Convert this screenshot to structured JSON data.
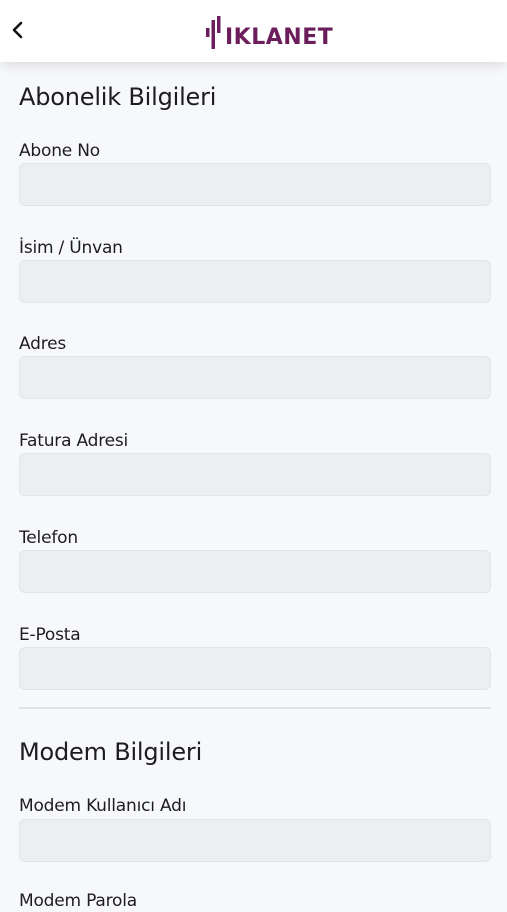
{
  "header": {
    "back_icon": "chevron-left-icon",
    "brand": "IKLANET",
    "brand_color": "#6b1d5c"
  },
  "sections": [
    {
      "title": "Abonelik Bilgileri",
      "fields": [
        {
          "label": "Abone No",
          "value": ""
        },
        {
          "label": "İsim / Ünvan",
          "value": ""
        },
        {
          "label": "Adres",
          "value": ""
        },
        {
          "label": "Fatura Adresi",
          "value": ""
        },
        {
          "label": "Telefon",
          "value": ""
        },
        {
          "label": "E-Posta",
          "value": ""
        }
      ]
    },
    {
      "title": "Modem Bilgileri",
      "fields": [
        {
          "label": "Modem Kullanıcı Adı",
          "value": ""
        },
        {
          "label": "Modem Parola",
          "value": ""
        }
      ]
    }
  ]
}
